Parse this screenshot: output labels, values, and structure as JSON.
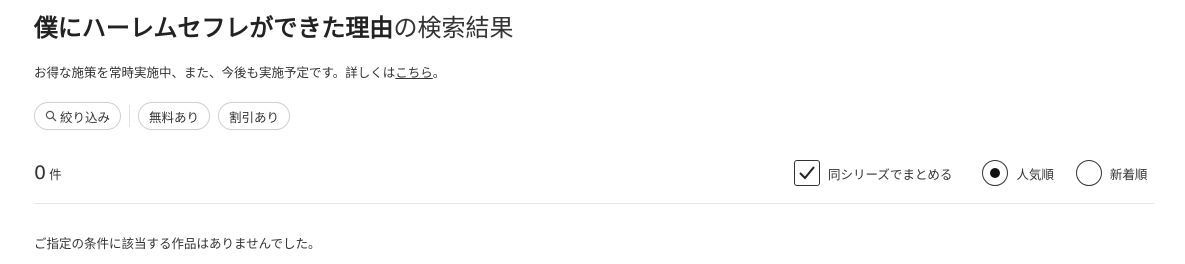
{
  "header": {
    "query": "僕にハーレムセフレができた理由",
    "suffix": "の検索結果"
  },
  "notice": {
    "text": "お得な施策を常時実施中、また、今後も実施予定です。詳しくは",
    "link": "こちら",
    "end": "。"
  },
  "filters": {
    "refine_label": "絞り込み",
    "refine_icon": "search-icon",
    "chips": [
      "無料あり",
      "割引あり"
    ]
  },
  "results": {
    "count": "0",
    "unit": "件",
    "empty_message": "ご指定の条件に該当する作品はありませんでした。"
  },
  "options": {
    "group_series_label": "同シリーズでまとめる",
    "group_series_checked": true,
    "sort_options": [
      {
        "label": "人気順",
        "selected": true
      },
      {
        "label": "新着順",
        "selected": false
      }
    ]
  }
}
